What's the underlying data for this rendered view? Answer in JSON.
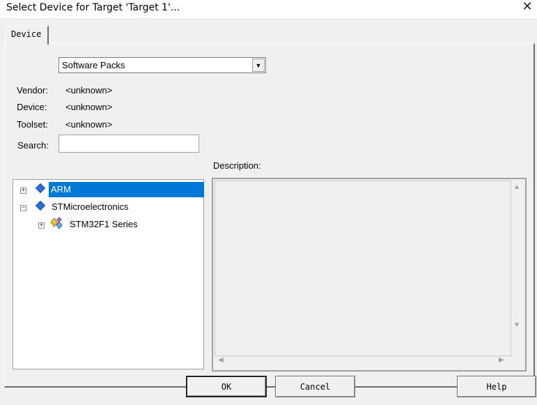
{
  "window": {
    "title": "Select Device for Target 'Target 1'...",
    "close_glyph": "✕"
  },
  "tabs": [
    {
      "label": "Device"
    }
  ],
  "pack_select": {
    "value": "Software Packs"
  },
  "fields": {
    "vendor": {
      "label": "Vendor:",
      "value": "<unknown>"
    },
    "device": {
      "label": "Device:",
      "value": "<unknown>"
    },
    "toolset": {
      "label": "Toolset:",
      "value": "<unknown>"
    },
    "search": {
      "label": "Search:",
      "value": ""
    }
  },
  "description": {
    "label": "Description:"
  },
  "tree": {
    "items": [
      {
        "label": "ARM",
        "selected": true,
        "expanded": false,
        "level": 0
      },
      {
        "label": "STMicroelectronics",
        "selected": false,
        "expanded": true,
        "level": 0
      },
      {
        "label": "STM32F1 Series",
        "selected": false,
        "expanded": false,
        "level": 1
      }
    ]
  },
  "buttons": {
    "ok": "OK",
    "cancel": "Cancel",
    "help": "Help"
  },
  "colors": {
    "selection": "#0078d7",
    "window_bg": "#f0f0f0"
  }
}
